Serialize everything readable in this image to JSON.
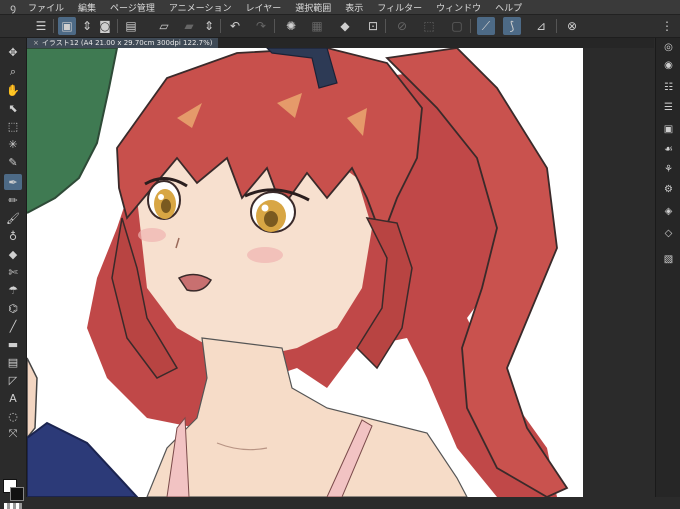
{
  "menu": {
    "items": [
      "ファイル",
      "編集",
      "ページ管理",
      "アニメーション",
      "レイヤー",
      "選択範囲",
      "表示",
      "フィルター",
      "ウィンドウ",
      "ヘルプ"
    ]
  },
  "tab": {
    "close": "×",
    "title": "イラスト12 (A4 21.00 x 29.70cm 300dpi 122.7%)"
  },
  "icons": {
    "app_logo": "clip-studio-logo-icon",
    "hamburger": "menu-icon"
  },
  "colors": {
    "accent": "#4d6a86",
    "hair": "#c24a4a",
    "skin": "#f6dcc8",
    "eyes": "#d8a644",
    "canvas": "#ffffff",
    "ui_bg": "#2b2b2b"
  }
}
